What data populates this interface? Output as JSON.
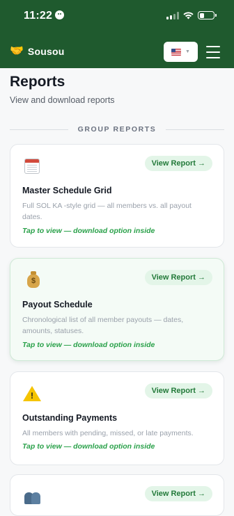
{
  "status_bar": {
    "time": "11:22"
  },
  "header": {
    "brand_icon": "handshake-icon",
    "brand_name": "Sousou",
    "language_flag": "us-flag-icon",
    "menu_icon": "hamburger-menu-icon"
  },
  "page": {
    "title": "Reports",
    "subtitle": "View and download reports",
    "section_label": "GROUP REPORTS"
  },
  "cards": [
    {
      "icon": "calendar-icon",
      "view_label": "View Report →",
      "title": "Master Schedule Grid",
      "description": "Full SOL KA        -style grid — all members vs. all payout dates.",
      "hint": "Tap to view — download option inside"
    },
    {
      "icon": "money-bag-icon",
      "view_label": "View Report →",
      "title": "Payout Schedule",
      "description": "Chronological list of all member payouts — dates, amounts, statuses.",
      "hint": "Tap to view — download option inside"
    },
    {
      "icon": "warning-icon",
      "view_label": "View Report →",
      "title": "Outstanding Payments",
      "description": "All members with pending, missed, or late payments.",
      "hint": "Tap to view — download option inside"
    },
    {
      "icon": "members-icon",
      "view_label": "View Report →"
    }
  ],
  "colors": {
    "brand_green": "#1f5a2e",
    "accent_green": "#2aa14a",
    "pill_bg": "#e3f5e8"
  }
}
